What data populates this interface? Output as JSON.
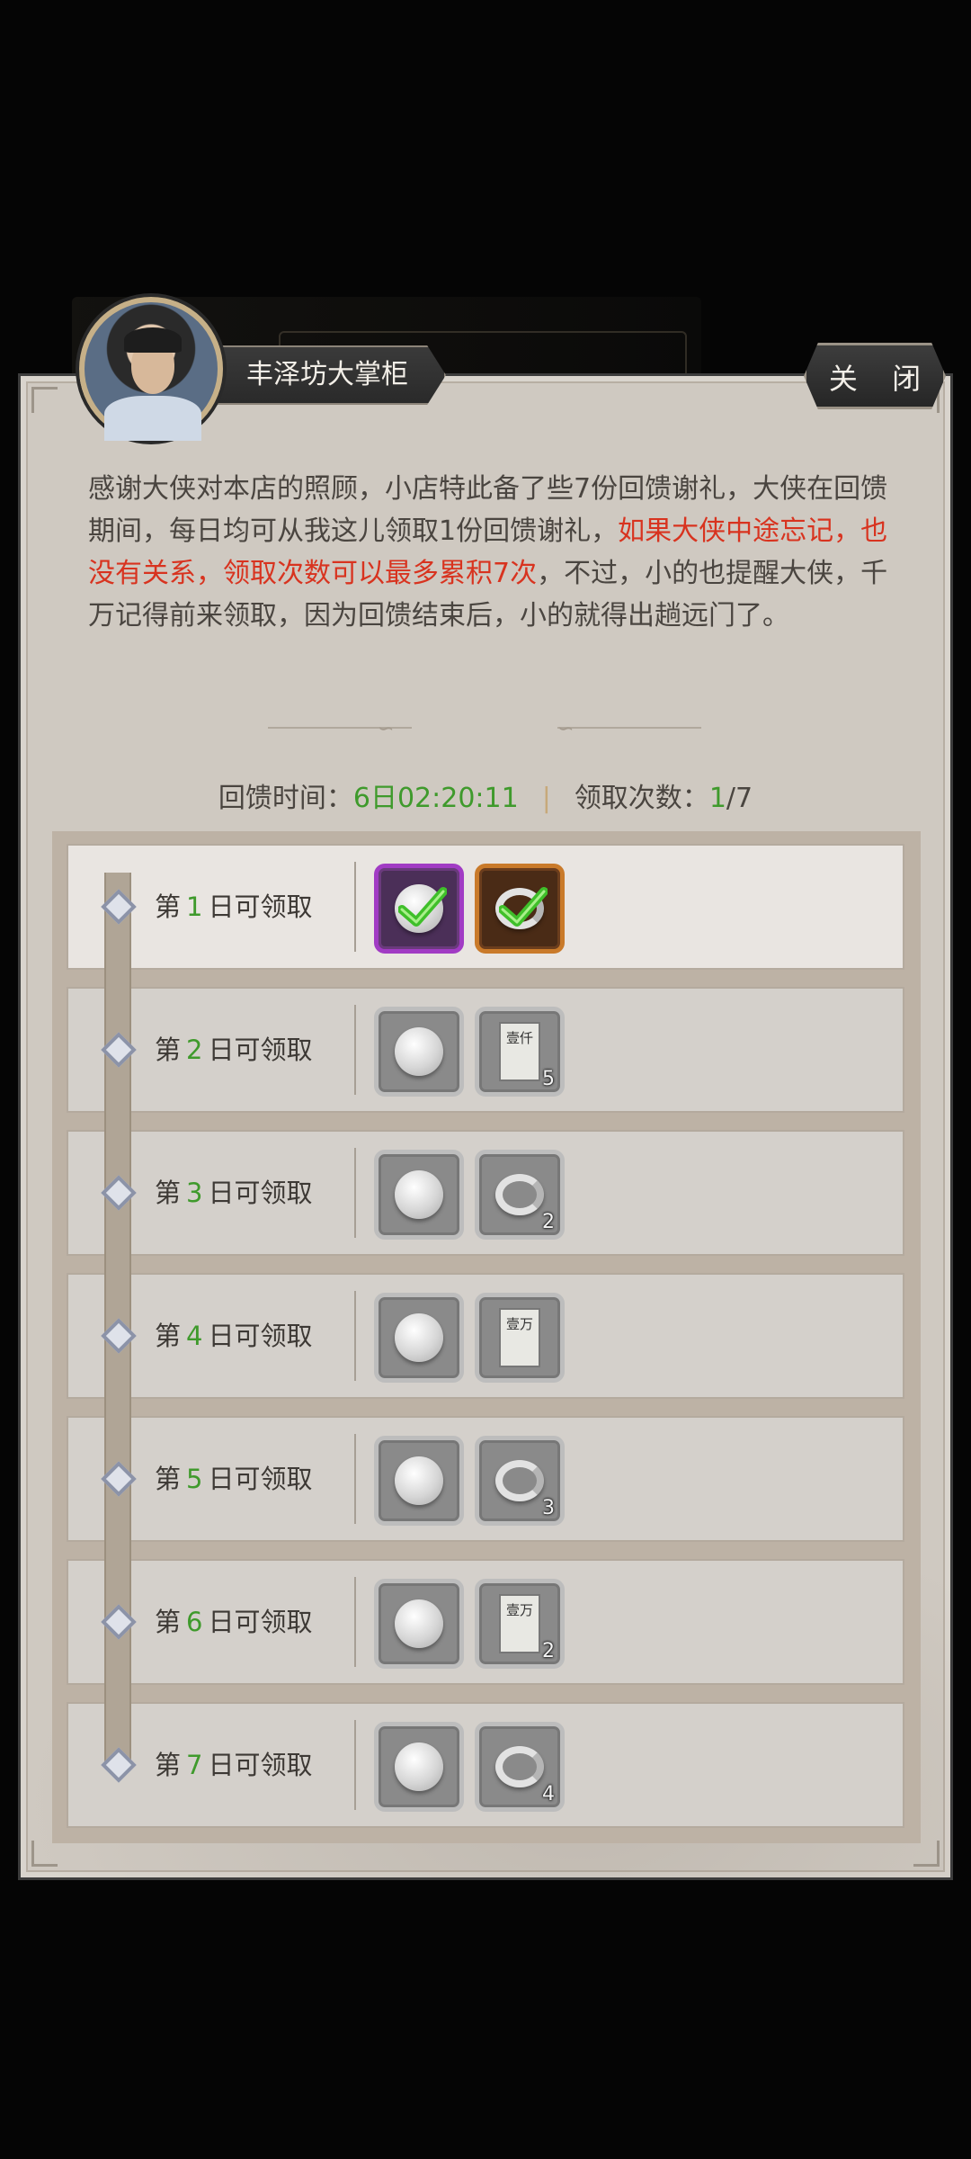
{
  "npc": {
    "name": "丰泽坊大掌柜"
  },
  "close_label": "关 闭",
  "intro": {
    "part1": "感谢大侠对本店的照顾，小店特此备了些7份回馈谢礼，大侠在回馈期间，每日均可从我这儿领取1份回馈谢礼，",
    "highlight": "如果大侠中途忘记，也没有关系，领取次数可以最多累积7次",
    "part2": "，不过，小的也提醒大侠，千万记得前来领取，因为回馈结束后，小的就得出趟远门了。"
  },
  "stats": {
    "time_label": "回馈时间：",
    "time_value": "6日02:20:11",
    "separator": "|",
    "count_label": "领取次数：",
    "count_value": "1",
    "count_total": "/7"
  },
  "days": [
    {
      "prefix": "第",
      "num": "1",
      "suffix": "日可领取",
      "claimed": true,
      "items": [
        {
          "icon": "silver-coin-icon",
          "qty": "",
          "frame": "purple"
        },
        {
          "icon": "silver-ingot-icon",
          "qty": "",
          "frame": "orange"
        }
      ]
    },
    {
      "prefix": "第",
      "num": "2",
      "suffix": "日可领取",
      "claimed": false,
      "items": [
        {
          "icon": "silver-coin-icon",
          "qty": ""
        },
        {
          "icon": "scroll-icon",
          "qty": "5",
          "scroll_text": "壹仟"
        }
      ]
    },
    {
      "prefix": "第",
      "num": "3",
      "suffix": "日可领取",
      "claimed": false,
      "items": [
        {
          "icon": "silver-coin-icon",
          "qty": ""
        },
        {
          "icon": "silver-ingot-icon",
          "qty": "2"
        }
      ]
    },
    {
      "prefix": "第",
      "num": "4",
      "suffix": "日可领取",
      "claimed": false,
      "items": [
        {
          "icon": "silver-coin-icon",
          "qty": ""
        },
        {
          "icon": "scroll-icon",
          "qty": "",
          "scroll_text": "壹万"
        }
      ]
    },
    {
      "prefix": "第",
      "num": "5",
      "suffix": "日可领取",
      "claimed": false,
      "items": [
        {
          "icon": "silver-coin-icon",
          "qty": ""
        },
        {
          "icon": "silver-ingot-icon",
          "qty": "3"
        }
      ]
    },
    {
      "prefix": "第",
      "num": "6",
      "suffix": "日可领取",
      "claimed": false,
      "items": [
        {
          "icon": "silver-coin-icon",
          "qty": ""
        },
        {
          "icon": "scroll-icon",
          "qty": "2",
          "scroll_text": "壹万"
        }
      ]
    },
    {
      "prefix": "第",
      "num": "7",
      "suffix": "日可领取",
      "claimed": false,
      "items": [
        {
          "icon": "silver-coin-icon",
          "qty": ""
        },
        {
          "icon": "silver-ingot-icon",
          "qty": "4"
        }
      ]
    }
  ],
  "colors": {
    "accent_green": "#3f9a2c",
    "highlight_red": "#d8331f",
    "frame_purple": "#a13bc4",
    "frame_orange": "#c97a2a"
  }
}
